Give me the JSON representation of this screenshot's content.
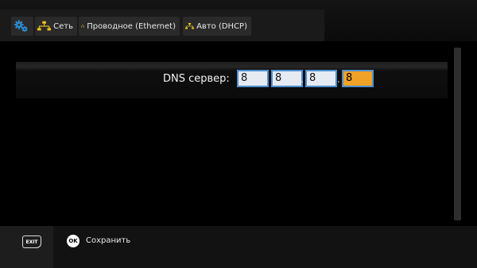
{
  "breadcrumb": {
    "root_icon": "gears-icon",
    "items": [
      {
        "label": "Сеть",
        "icon": "network-icon"
      },
      {
        "label": "Проводное (Ethernet)",
        "icon": "network-icon"
      },
      {
        "label": "Авто (DHCP)",
        "icon": "network-icon"
      }
    ]
  },
  "dns": {
    "label": "DNS сервер:",
    "octets": [
      "8",
      "8",
      "8",
      "8"
    ],
    "separator": ".",
    "focused_octet": 3
  },
  "footer": {
    "exit_key": "EXIT",
    "ok_key": "OK",
    "save_label": "Сохранить"
  },
  "colors": {
    "accent": "#f0a128",
    "field_border": "#4d8fcf",
    "icon_yellow": "#e8c21a",
    "gear_blue": "#2b8fd6"
  }
}
